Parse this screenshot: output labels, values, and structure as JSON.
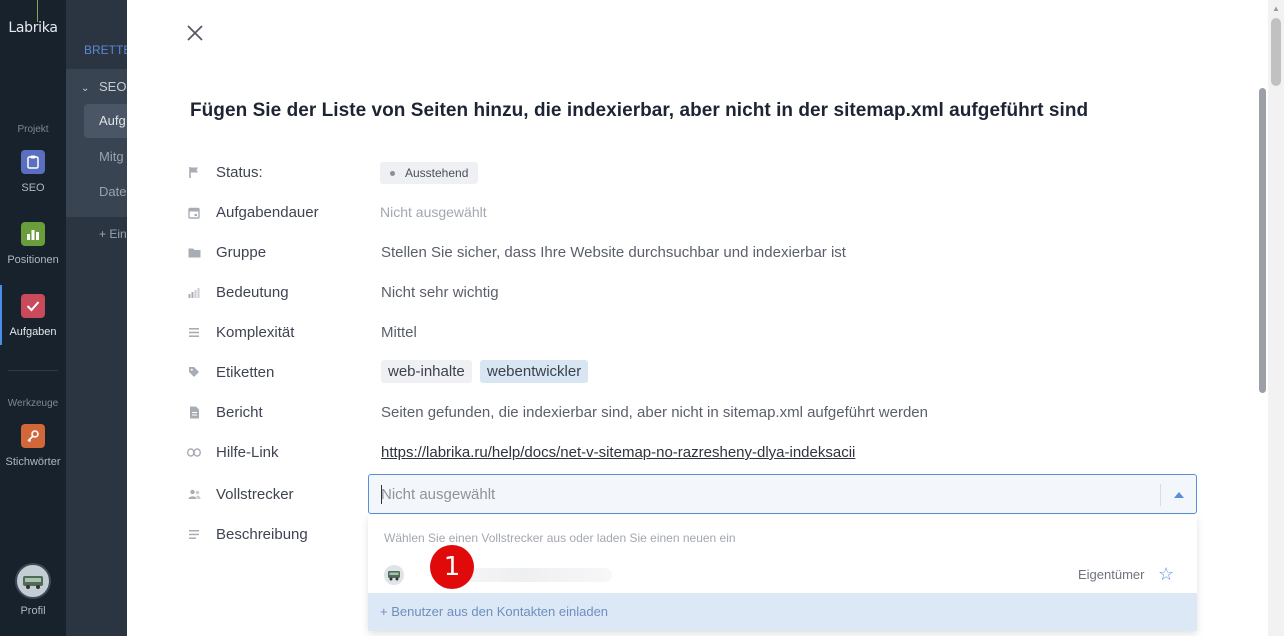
{
  "app": {
    "logo": "Labrika"
  },
  "sidebar": {
    "section_projekt": "Projekt",
    "section_werkzeuge": "Werkzeuge",
    "items": [
      {
        "label": "SEO",
        "icon": "clipboard-icon",
        "color": "#5a6fbf"
      },
      {
        "label": "Positionen",
        "icon": "chart-icon",
        "color": "#6a9d3c"
      },
      {
        "label": "Aufgaben",
        "icon": "check-icon",
        "color": "#c94a5a"
      },
      {
        "label": "Stichwörter",
        "icon": "key-icon",
        "color": "#d2683a"
      }
    ],
    "profile_label": "Profil"
  },
  "panel": {
    "board_label": "BRETTE",
    "group_label": "SEO-",
    "rows": [
      "Aufg",
      "Mitg",
      "Date"
    ],
    "add_label": "+ Ein"
  },
  "modal": {
    "title": "Fügen Sie der Liste von Seiten hinzu, die indexierbar, aber nicht in der sitemap.xml aufgeführt sind",
    "fields": {
      "status": {
        "label": "Status:",
        "value": "Ausstehend"
      },
      "dauer": {
        "label": "Aufgabendauer",
        "value": "Nicht ausgewählt"
      },
      "gruppe": {
        "label": "Gruppe",
        "value": "Stellen Sie sicher, dass Ihre Website durchsuchbar und indexierbar ist"
      },
      "bedeutung": {
        "label": "Bedeutung",
        "value": "Nicht sehr wichtig"
      },
      "komplexitaet": {
        "label": "Komplexität",
        "value": "Mittel"
      },
      "etiketten": {
        "label": "Etiketten",
        "tags": [
          "web-inhalte",
          "webentwickler"
        ]
      },
      "bericht": {
        "label": "Bericht",
        "value": "Seiten gefunden, die indexierbar sind, aber nicht in sitemap.xml aufgeführt werden"
      },
      "hilfe": {
        "label": "Hilfe-Link",
        "value": "https://labrika.ru/help/docs/net-v-sitemap-no-razresheny-dlya-indeksacii"
      },
      "vollstrecker": {
        "label": "Vollstrecker",
        "placeholder": "Nicht ausgewählt"
      },
      "beschreibung": {
        "label": "Beschreibung"
      }
    },
    "dropdown": {
      "hint": "Wählen Sie einen Vollstrecker aus oder laden Sie einen neuen ein",
      "user_role": "Eigentümer",
      "invite_label": "+  Benutzer aus den Kontakten einladen"
    },
    "marker": "1"
  }
}
